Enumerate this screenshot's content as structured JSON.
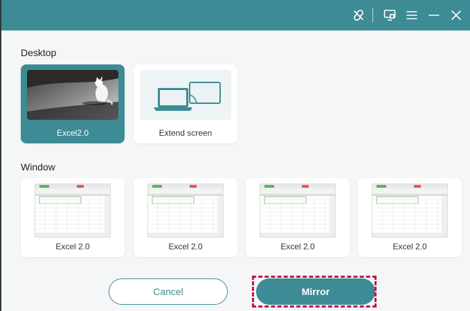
{
  "colors": {
    "accent": "#3d8b94",
    "highlight": "#c2154a"
  },
  "titlebar": {
    "icons": [
      "link-off-icon",
      "screen-cast-icon",
      "menu-icon",
      "minimize-icon",
      "close-icon"
    ]
  },
  "desktop": {
    "title": "Desktop",
    "items": [
      {
        "label": "Excel2.0",
        "selected": true
      },
      {
        "label": "Extend screen",
        "selected": false
      }
    ]
  },
  "window": {
    "title": "Window",
    "items": [
      {
        "label": "Excel 2.0"
      },
      {
        "label": "Excel 2.0"
      },
      {
        "label": "Excel 2.0"
      },
      {
        "label": "Excel 2.0"
      }
    ]
  },
  "buttons": {
    "cancel": "Cancel",
    "mirror": "Mirror"
  }
}
